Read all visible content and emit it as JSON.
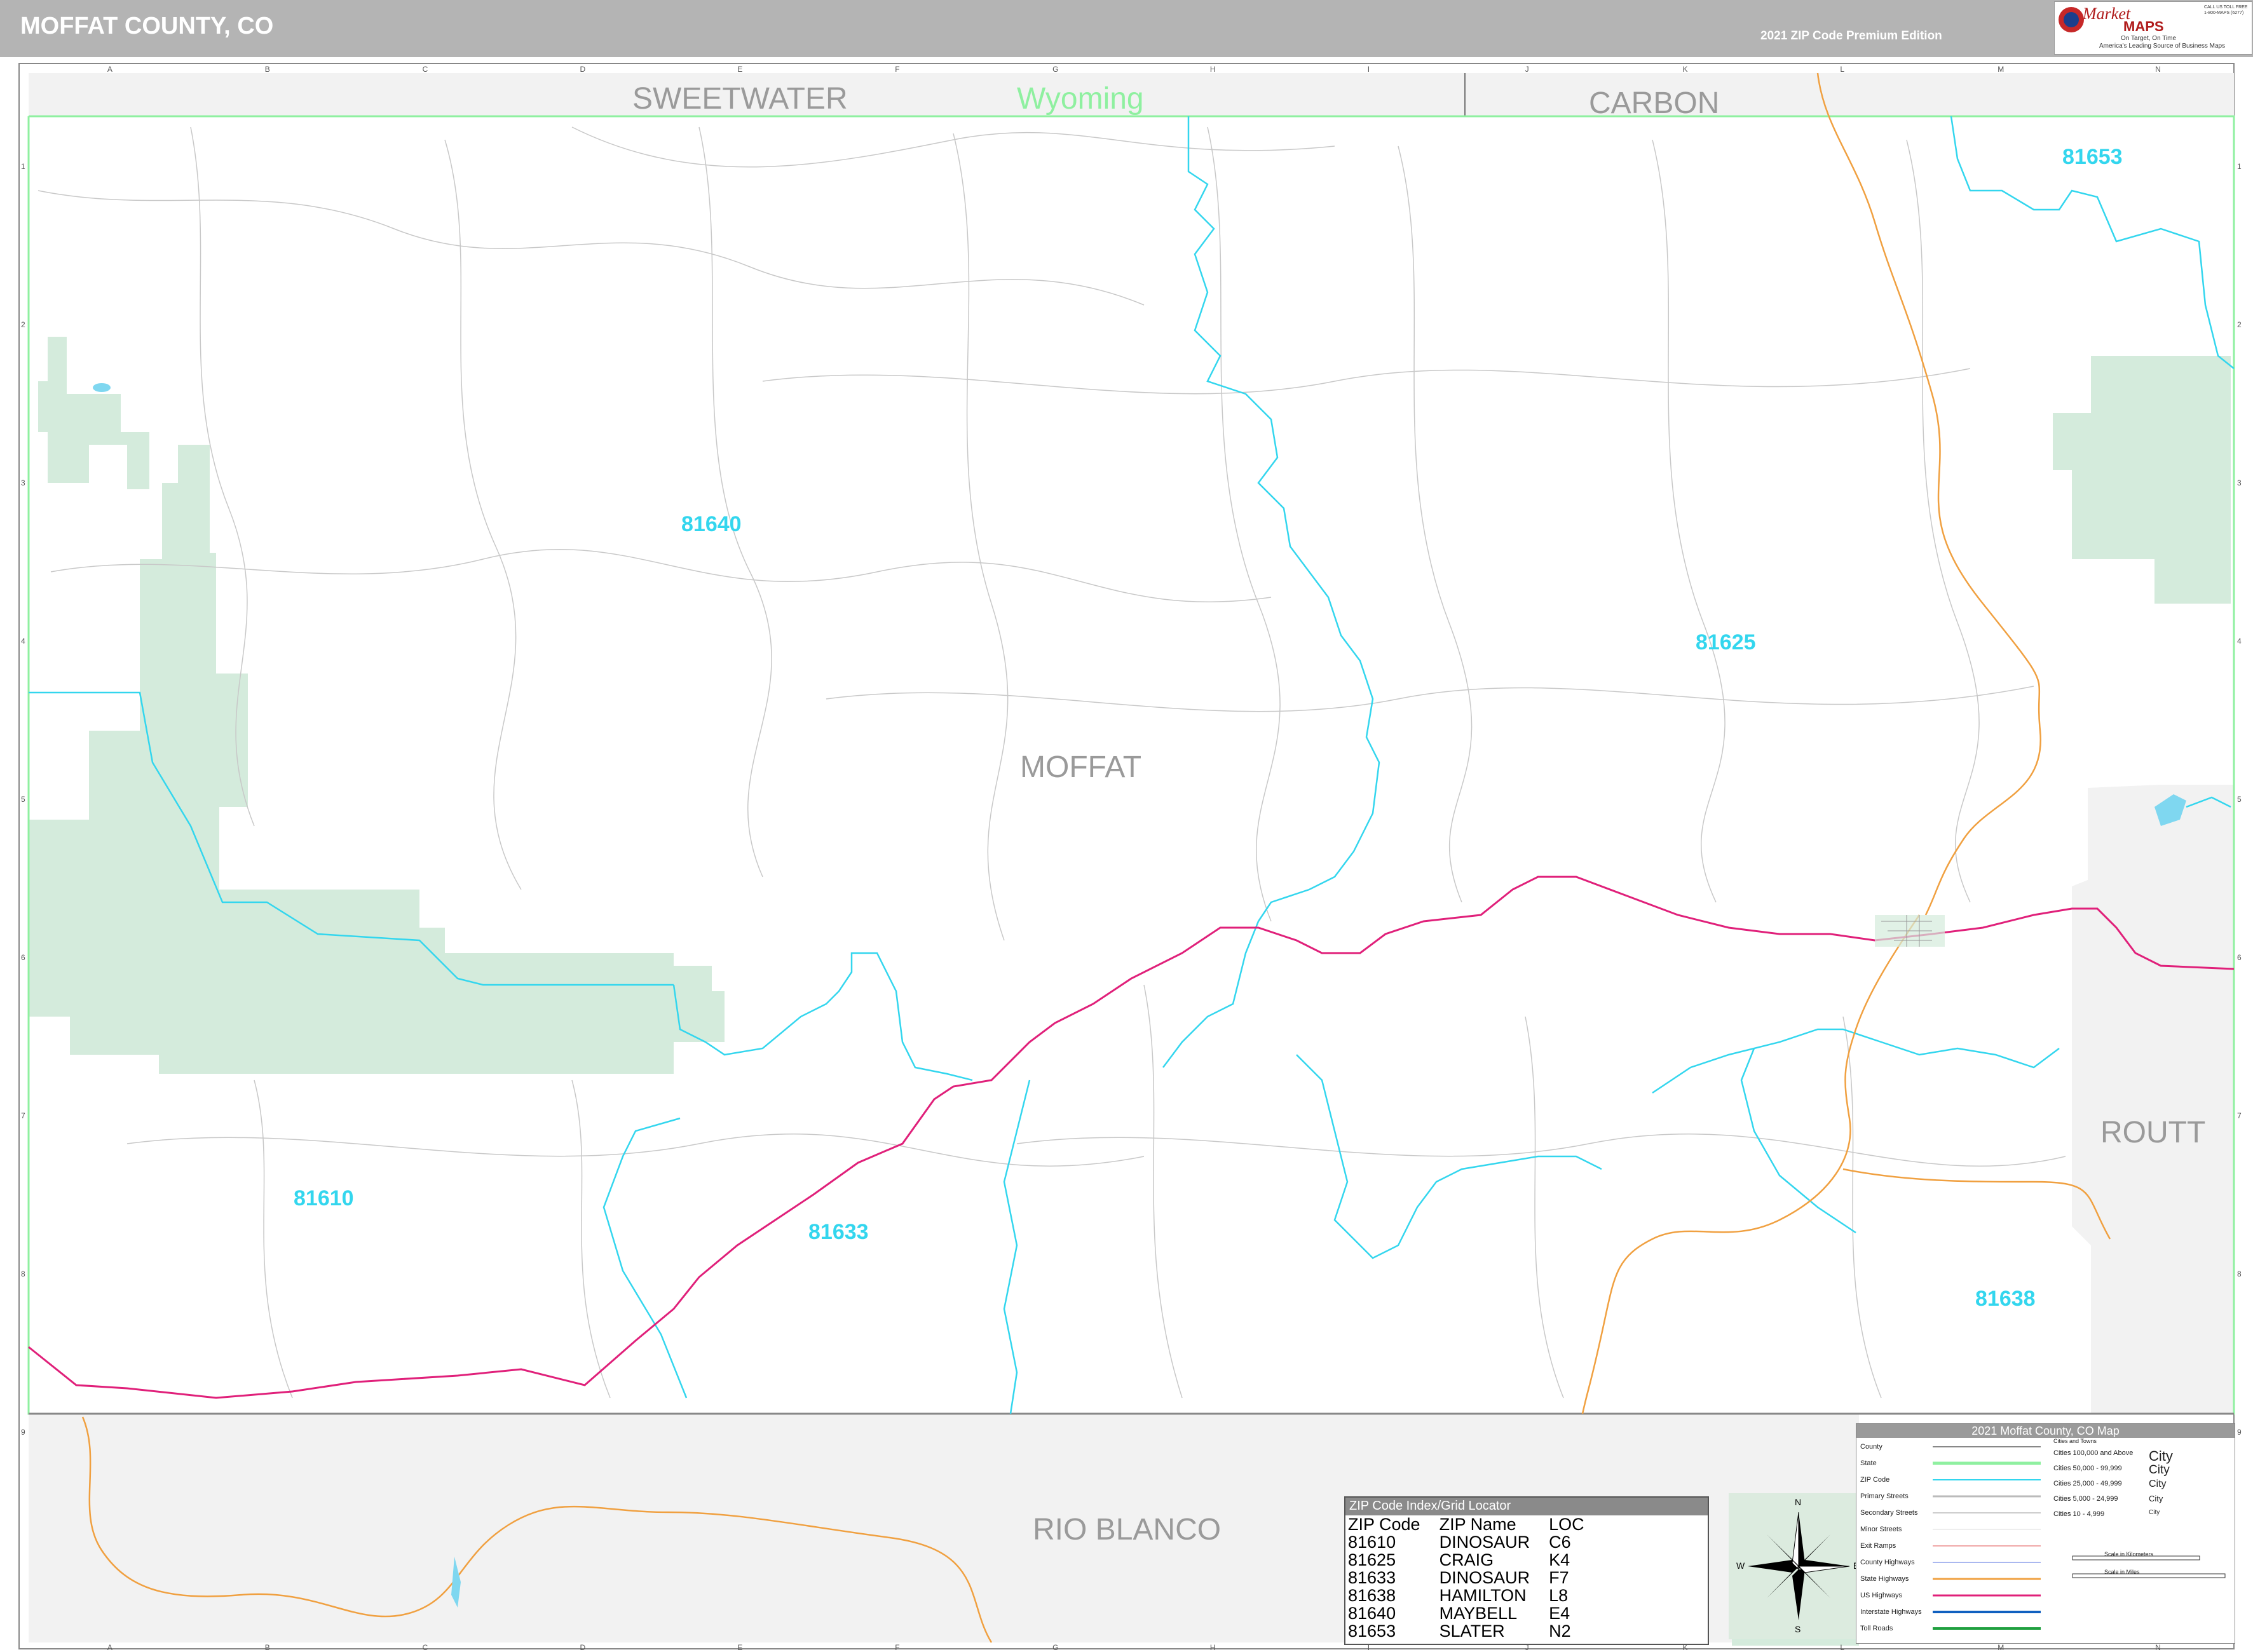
{
  "header": {
    "title": "MOFFAT COUNTY, CO",
    "edition": "2021 ZIP Code Premium Edition",
    "logo": {
      "brand": "Market",
      "maps": "MAPS",
      "tagline1": "On Target, On Time",
      "tagline2": "America's Leading Source of Business Maps",
      "contact": "CALL US TOLL FREE 1-800-MAPS (6277)",
      "icon": "globe-target-icon"
    }
  },
  "map": {
    "grid_columns": [
      "A",
      "B",
      "C",
      "D",
      "E",
      "F",
      "G",
      "H",
      "I",
      "J",
      "K",
      "L",
      "M",
      "N"
    ],
    "grid_rows": [
      "1",
      "2",
      "3",
      "4",
      "5",
      "6",
      "7",
      "8",
      "9"
    ],
    "neighbor_counties": [
      "SWEETWATER",
      "CARBON",
      "ROUTT",
      "RIO BLANCO"
    ],
    "state_label": "Wyoming",
    "county_label": "MOFFAT",
    "zip_labels": [
      "81653",
      "81640",
      "81625",
      "81610",
      "81633",
      "81638"
    ]
  },
  "zip_index": {
    "title": "ZIP Code Index/Grid Locator",
    "headers": [
      "ZIP Code",
      "ZIP Name",
      "LOC"
    ],
    "rows": [
      [
        "81610",
        "DINOSAUR",
        "C6"
      ],
      [
        "81625",
        "CRAIG",
        "K4"
      ],
      [
        "81633",
        "DINOSAUR",
        "F7"
      ],
      [
        "81638",
        "HAMILTON",
        "L8"
      ],
      [
        "81640",
        "MAYBELL",
        "E4"
      ],
      [
        "81653",
        "SLATER",
        "N2"
      ]
    ]
  },
  "compass": {
    "n": "N",
    "s": "S",
    "e": "E",
    "w": "W",
    "icon": "compass-rose-icon"
  },
  "legend": {
    "title": "2021 Moffat County, CO Map",
    "cities_header": "Cities and Towns",
    "items": [
      "County",
      "State",
      "ZIP Code",
      "Primary Streets",
      "Secondary Streets",
      "Minor Streets",
      "Exit Ramps",
      "County Highways",
      "State Highways",
      "US Highways",
      "Interstate Highways",
      "Toll Roads"
    ],
    "colors": {
      "county": "#888888",
      "state": "#8ff0a0",
      "zip": "#33d6ee",
      "primary": "#cccccc",
      "state_hwy": "#f0a040",
      "us_hwy": "#e0207a",
      "interstate": "#1060c0",
      "toll": "#20a040",
      "forest": "#d4ebdc"
    },
    "cities": [
      {
        "range": "Cities 100,000 and Above",
        "sample": "City"
      },
      {
        "range": "Cities 50,000 - 99,999",
        "sample": "City"
      },
      {
        "range": "Cities 25,000 - 49,999",
        "sample": "City"
      },
      {
        "range": "Cities 5,000 - 24,999",
        "sample": "City"
      },
      {
        "range": "Cities 10 - 4,999",
        "sample": "City"
      }
    ],
    "scale_km": "Scale in Kilometers",
    "scale_mi": "Scale in Miles"
  }
}
